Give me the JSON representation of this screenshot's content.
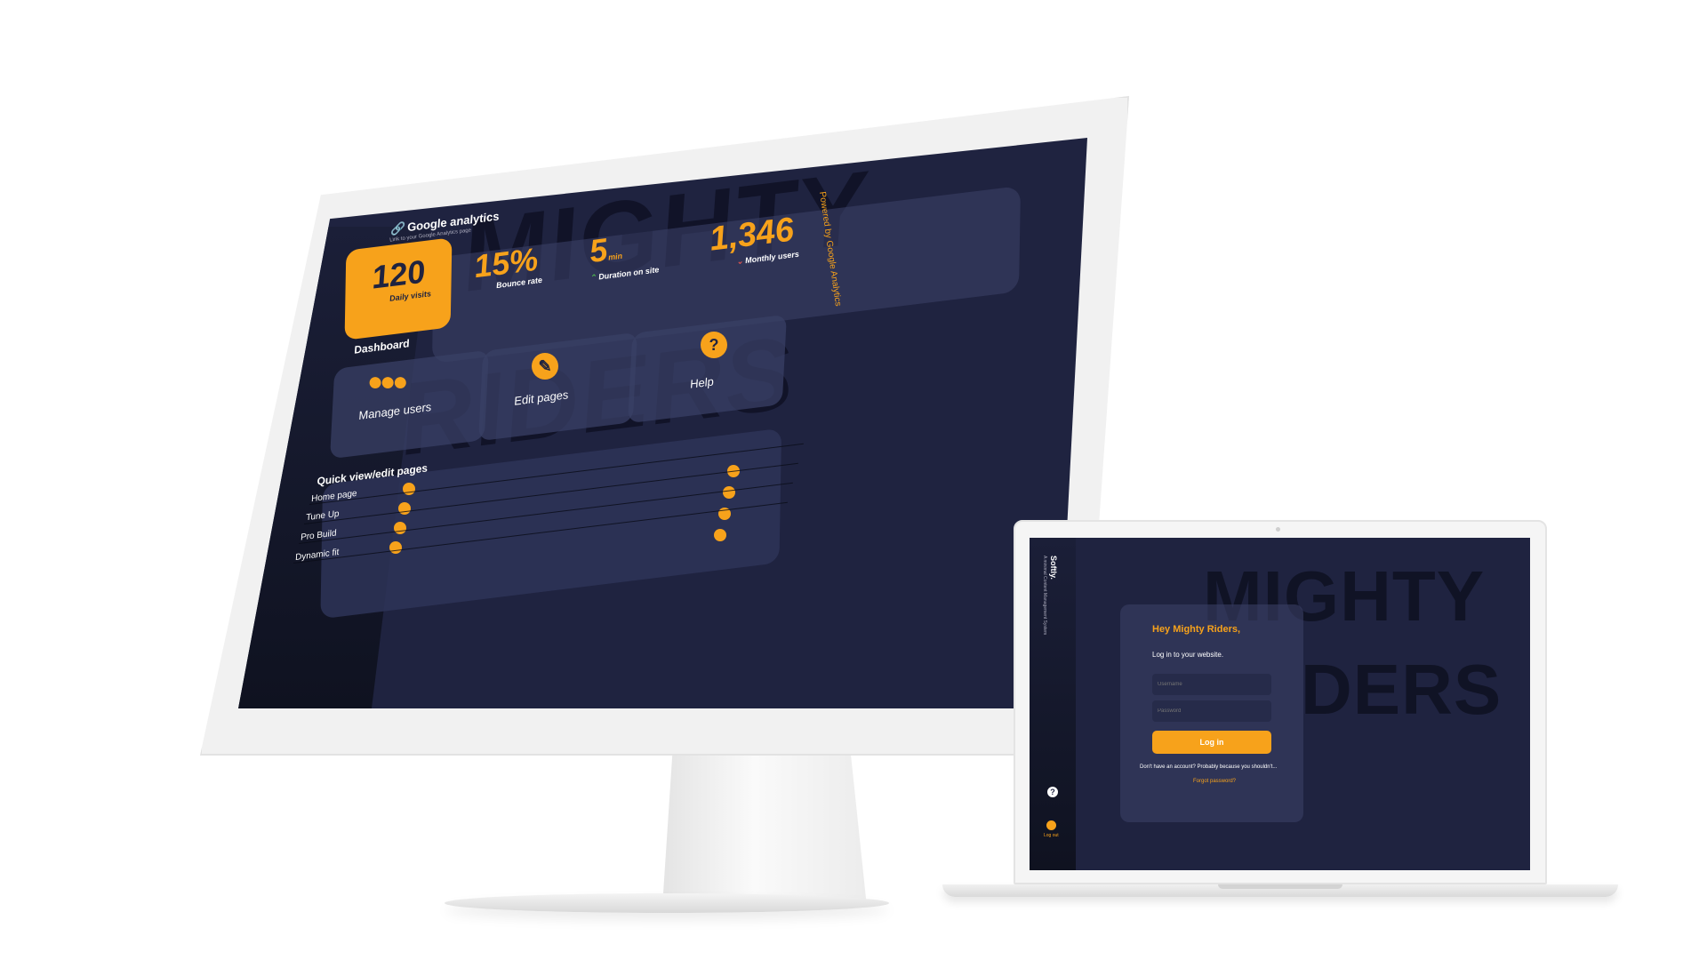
{
  "brand": "Softly.",
  "brand_tagline": "A minimal Content Management System",
  "watermark": {
    "line1": "MIGHTY",
    "line2": "RIDERS",
    "laptop_line1": "MIGHTY",
    "laptop_line2": "DERS"
  },
  "analytics": {
    "title": "Google analytics",
    "subtitle": "Link to your Google Analytics page",
    "powered_by": "Powered by Google Analytics",
    "stats": [
      {
        "value": "120",
        "label": "Daily visits"
      },
      {
        "value": "15%",
        "label": "Bounce rate"
      },
      {
        "value": "5",
        "unit": "min",
        "label": "Duration on site"
      },
      {
        "value": "1,346",
        "label": "Monthly users"
      }
    ]
  },
  "dashboard": {
    "title": "Dashboard",
    "cards": [
      {
        "label": "Manage users",
        "icon": "users-icon"
      },
      {
        "label": "Edit pages",
        "icon": "pencil-icon"
      },
      {
        "label": "Help",
        "icon": "question-icon"
      }
    ]
  },
  "quick_view": {
    "title": "Quick view/edit pages",
    "pages": [
      "Home page",
      "Tune Up",
      "Pro Build",
      "Dynamic fit"
    ]
  },
  "sidebar": {
    "logout_label": "Log out"
  },
  "login": {
    "greeting": "Hey Mighty Riders,",
    "subtitle": "Log in to your website.",
    "username_placeholder": "Username",
    "password_placeholder": "Password",
    "button": "Log in",
    "no_account": "Don't have an account? Probably because you shouldn't...",
    "forgot": "Forgot password?",
    "logout_label": "Log out"
  },
  "colors": {
    "accent": "#f7a21b",
    "background": "#1f2340",
    "panel": "#3a4066"
  }
}
